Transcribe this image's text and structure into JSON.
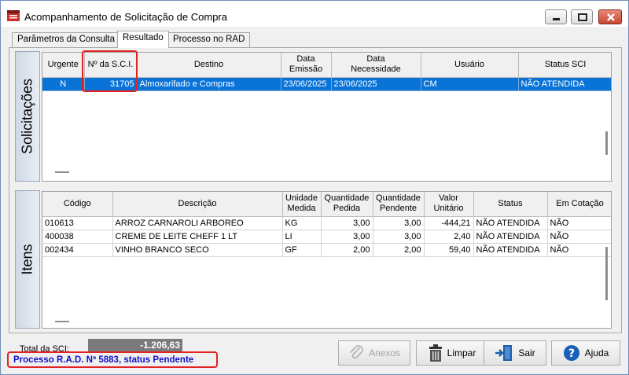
{
  "window": {
    "title": "Acompanhamento de Solicitação de Compra"
  },
  "tabs": [
    {
      "label": "Parâmetros da Consulta",
      "active": false
    },
    {
      "label": "Resultado",
      "active": true
    },
    {
      "label": "Processo no RAD",
      "active": false
    }
  ],
  "solicitacoes": {
    "side_label": "Solicitações",
    "columns": [
      {
        "line1": "Urgente",
        "line2": ""
      },
      {
        "line1": "Nº da S.C.I.",
        "line2": ""
      },
      {
        "line1": "Destino",
        "line2": ""
      },
      {
        "line1": "Data",
        "line2": "Emissão"
      },
      {
        "line1": "Data",
        "line2": "Necessidade"
      },
      {
        "line1": "Usuário",
        "line2": ""
      },
      {
        "line1": "Status SCI",
        "line2": ""
      }
    ],
    "rows": [
      {
        "urgente": "N",
        "numero": "31705",
        "destino": "Almoxarifado e Compras",
        "emissao": "23/06/2025",
        "necessidade": "23/06/2025",
        "usuario": "CM",
        "status": "NÃO ATENDIDA",
        "selected": true
      }
    ]
  },
  "itens": {
    "side_label": "Itens",
    "columns": [
      {
        "line1": "Código",
        "line2": ""
      },
      {
        "line1": "Descrição",
        "line2": ""
      },
      {
        "line1": "Unidade",
        "line2": "Medida"
      },
      {
        "line1": "Quantidade",
        "line2": "Pedida"
      },
      {
        "line1": "Quantidade",
        "line2": "Pendente"
      },
      {
        "line1": "Valor",
        "line2": "Unitário"
      },
      {
        "line1": "Status",
        "line2": ""
      },
      {
        "line1": "Em Cotação",
        "line2": ""
      }
    ],
    "rows": [
      {
        "codigo": "010613",
        "descricao": "ARROZ  CARNAROLI  ARBOREO",
        "unidade": "KG",
        "qtd_pedida": "3,00",
        "qtd_pendente": "3,00",
        "valor": "-444,21",
        "status": "NÃO ATENDIDA",
        "cotacao": "NÃO"
      },
      {
        "codigo": "400038",
        "descricao": "CREME DE LEITE CHEFF 1 LT",
        "unidade": "LI",
        "qtd_pedida": "3,00",
        "qtd_pendente": "3,00",
        "valor": "2,40",
        "status": "NÃO ATENDIDA",
        "cotacao": "NÃO"
      },
      {
        "codigo": "002434",
        "descricao": "VINHO BRANCO SECO",
        "unidade": "GF",
        "qtd_pedida": "2,00",
        "qtd_pendente": "2,00",
        "valor": "59,40",
        "status": "NÃO ATENDIDA",
        "cotacao": "NÃO"
      }
    ]
  },
  "footer": {
    "total_label": "Total da SCI:",
    "total_value": "-1.206,63",
    "status_message": "Processo R.A.D. Nº 5883, status Pendente",
    "buttons": [
      {
        "label": "Anexos",
        "enabled": false
      },
      {
        "label": "Limpar",
        "enabled": true
      },
      {
        "label": "Sair",
        "enabled": true
      },
      {
        "label": "Ajuda",
        "enabled": true
      }
    ]
  },
  "colors": {
    "selection": "#0a73d8",
    "highlight_border": "#e32222",
    "status_text": "#1010c8"
  }
}
